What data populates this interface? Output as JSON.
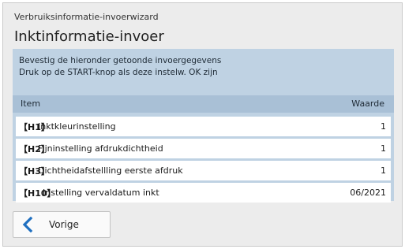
{
  "wizard": {
    "name": "Verbruiksinformatie-invoerwizard",
    "title": "Inktinformatie-invoer"
  },
  "instructions": {
    "line1": "Bevestig de hieronder getoonde invoergegevens",
    "line2": "Druk op de START-knop als deze instelw. OK zijn"
  },
  "table": {
    "col_item": "Item",
    "col_value": "Waarde",
    "rows": [
      {
        "code": "【H1】",
        "label": "Inktkleurinstelling",
        "value": "1"
      },
      {
        "code": "【H2】",
        "label": "Fijninstelling afdrukdichtheid",
        "value": "1"
      },
      {
        "code": "【H3】",
        "label": "Dichtheidafstellling eerste afdruk",
        "value": "1"
      },
      {
        "code": "【H10】",
        "label": "Instelling vervaldatum inkt",
        "value": "06/2021"
      }
    ]
  },
  "buttons": {
    "back_label": "Vorige",
    "back_icon": "chevron-left-icon",
    "accent_color": "#1f6fc0"
  }
}
